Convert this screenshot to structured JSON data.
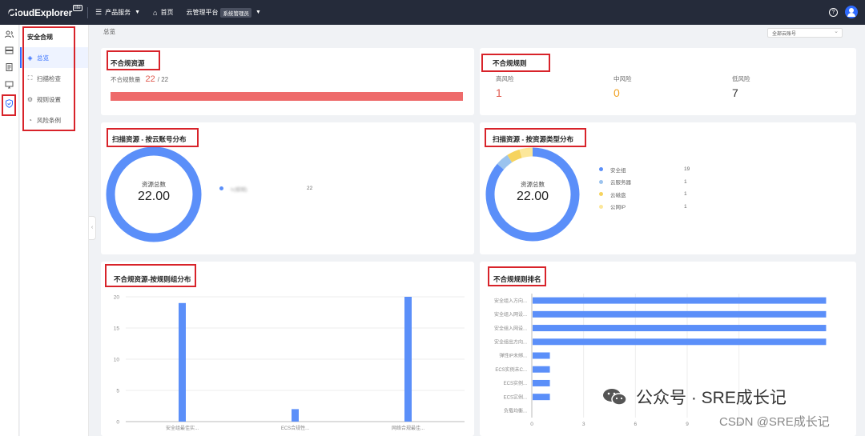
{
  "topbar": {
    "logo_text": "CloudExplorer",
    "logo_badge": "lite",
    "nav_products": "产品服务",
    "nav_home": "首页",
    "nav_platform": "云管理平台",
    "env_tag": "系统管理员",
    "help_glyph": "?"
  },
  "sidebar": {
    "title": "安全合规",
    "items": [
      {
        "label": "总览",
        "icon": "overview-icon",
        "active": true
      },
      {
        "label": "扫描检查",
        "icon": "scan-icon",
        "active": false
      },
      {
        "label": "规则设置",
        "icon": "rule-icon",
        "active": false
      },
      {
        "label": "风险条例",
        "icon": "risk-icon",
        "active": false
      }
    ]
  },
  "breadcrumb": "总览",
  "account_select": "全部云账号",
  "noncompliant_resources": {
    "title": "不合规资源",
    "count_label": "不合规数量",
    "count": "22",
    "total": "/ 22",
    "ratio": 1.0,
    "bar_color": "#ee6b6b"
  },
  "noncompliant_rules": {
    "title": "不合规规则",
    "levels": [
      {
        "label": "高风险",
        "value": "1",
        "color": "#e05a4f"
      },
      {
        "label": "中风险",
        "value": "0",
        "color": "#f0a020"
      },
      {
        "label": "低风险",
        "value": "7",
        "color": "#333333"
      }
    ]
  },
  "scan_by_account": {
    "title": "扫描资源 - 按云账号分布",
    "center_label": "资源总数",
    "center_value": "22.00",
    "legend": [
      {
        "name": "h(模糊)",
        "value": "22",
        "color": "#5b8ff9"
      }
    ],
    "chart_data": {
      "type": "pie",
      "categories": [
        "h(模糊)"
      ],
      "values": [
        22
      ]
    }
  },
  "scan_by_type": {
    "title": "扫描资源 - 按资源类型分布",
    "center_label": "资源总数",
    "center_value": "22.00",
    "legend": [
      {
        "name": "安全组",
        "value": "19",
        "color": "#5b8ff9"
      },
      {
        "name": "云服务器",
        "value": "1",
        "color": "#9bc3ee"
      },
      {
        "name": "云磁盘",
        "value": "1",
        "color": "#f6d35e"
      },
      {
        "name": "公网IP",
        "value": "1",
        "color": "#fce79a"
      }
    ],
    "chart_data": {
      "type": "pie",
      "categories": [
        "安全组",
        "云服务器",
        "云磁盘",
        "公网IP"
      ],
      "values": [
        19,
        1,
        1,
        1
      ]
    }
  },
  "by_rule_group": {
    "title": "不合规资源-按规则组分布",
    "chart_data": {
      "type": "bar",
      "categories": [
        "安全组最佳实...",
        "ECS合规性...",
        "网络合规最佳..."
      ],
      "values": [
        19,
        2,
        20
      ],
      "ylim": [
        0,
        20
      ],
      "yticks": [
        0,
        5,
        10,
        15,
        20
      ],
      "color": "#5b8ff9"
    }
  },
  "rule_ranking": {
    "title": "不合规规则排名",
    "chart_data": {
      "type": "bar",
      "orientation": "horizontal",
      "categories": [
        "安全组入方向...",
        "安全组入网设...",
        "安全组入网设...",
        "安全组出方向...",
        "弹性IP未绑...",
        "ECS实例未C...",
        "ECS实例...",
        "ECS实例...",
        "负载均衡..."
      ],
      "values": [
        17,
        17,
        17,
        17,
        1,
        1,
        1,
        1,
        0
      ],
      "xlim": [
        0,
        18
      ],
      "xticks": [
        0,
        3,
        6,
        9,
        12
      ],
      "color": "#5b8ff9"
    }
  },
  "watermark": {
    "text": "公众号 · SRE成长记",
    "csdn": "CSDN @SRE成长记"
  }
}
